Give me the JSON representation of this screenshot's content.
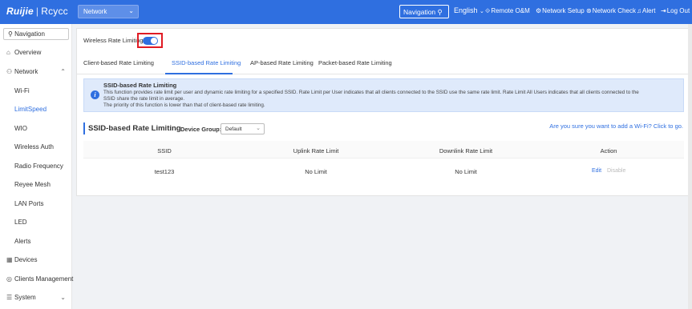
{
  "topbar": {
    "brand": "Ruijie",
    "brand_sub": "Rcycc",
    "network_select": "Network",
    "navigation_search": "Navigation",
    "language": "English",
    "remote_om": "Remote O&M",
    "network_setup": "Network Setup",
    "network_check": "Network Check",
    "alert": "Alert",
    "log_out": "Log Out"
  },
  "sidebar": {
    "navigation": "Navigation",
    "items": [
      {
        "label": "Overview"
      },
      {
        "label": "Network"
      },
      {
        "label": "Wi-Fi"
      },
      {
        "label": "LimitSpeed"
      },
      {
        "label": "WIO"
      },
      {
        "label": "Wireless Auth"
      },
      {
        "label": "Radio Frequency"
      },
      {
        "label": "Reyee Mesh"
      },
      {
        "label": "LAN Ports"
      },
      {
        "label": "LED"
      },
      {
        "label": "Alerts"
      },
      {
        "label": "Devices"
      },
      {
        "label": "Clients Management"
      },
      {
        "label": "System"
      }
    ]
  },
  "main": {
    "wireless_rate_limiting_label": "Wireless Rate Limiting",
    "wireless_rate_limiting_enabled": true,
    "tabs": [
      {
        "label": "Client-based Rate Limiting"
      },
      {
        "label": "SSID-based Rate Limiting"
      },
      {
        "label": "AP-based Rate Limiting"
      },
      {
        "label": "Packet-based Rate Limiting"
      }
    ],
    "active_tab": "SSID-based Rate Limiting",
    "info": {
      "title": "SSID-based Rate Limiting",
      "line1": "This function provides rate limit per user and dynamic rate limiting for a specified SSID. Rate Limit per User indicates that all clients connected to the SSID use the same rate limit. Rate Limit All Users indicates that all clients connected to the",
      "line2": "SSID share the rate limit in average.",
      "line3": "The priority of this function is lower than that of client-based rate limiting."
    },
    "section_title": "SSID-based Rate Limiting",
    "device_group_label": "Device Group:",
    "device_group_value": "Default",
    "wifi_link": "Are you sure you want to add a Wi-Fi? Click to go.",
    "table": {
      "headers": [
        "SSID",
        "Uplink Rate Limit",
        "Downlink Rate Limit",
        "Action"
      ],
      "rows": [
        {
          "ssid": "test123",
          "uplink": "No Limit",
          "downlink": "No Limit",
          "edit": "Edit",
          "disable": "Disable"
        }
      ]
    }
  },
  "colors": {
    "accent": "#2f6fe0",
    "highlight_border": "#e01b24"
  }
}
